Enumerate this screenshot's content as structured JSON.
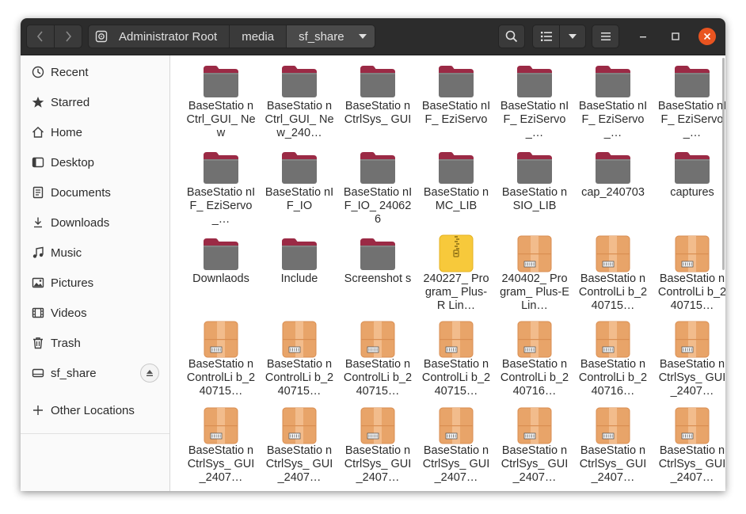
{
  "header": {
    "breadcrumbs": [
      "Administrator Root",
      "media",
      "sf_share"
    ],
    "icons": {
      "back": "chevron-left-icon",
      "forward": "chevron-right-icon",
      "search": "search-icon",
      "view": "list-view-icon",
      "view_dropdown": "chevron-down-icon",
      "menu": "hamburger-menu-icon",
      "minimize": "minimize-icon",
      "maximize": "maximize-icon",
      "close": "close-icon"
    }
  },
  "sidebar": {
    "items": [
      {
        "label": "Recent",
        "icon": "clock-icon"
      },
      {
        "label": "Starred",
        "icon": "star-icon"
      },
      {
        "label": "Home",
        "icon": "home-icon"
      },
      {
        "label": "Desktop",
        "icon": "desktop-icon"
      },
      {
        "label": "Documents",
        "icon": "document-icon"
      },
      {
        "label": "Downloads",
        "icon": "download-icon"
      },
      {
        "label": "Music",
        "icon": "music-icon"
      },
      {
        "label": "Pictures",
        "icon": "picture-icon"
      },
      {
        "label": "Videos",
        "icon": "video-icon"
      },
      {
        "label": "Trash",
        "icon": "trash-icon"
      },
      {
        "label": "sf_share",
        "icon": "drive-icon"
      }
    ],
    "other_locations": "Other Locations"
  },
  "files": [
    {
      "label": "BaseStatio nCtrl_GUI_ New",
      "type": "folder"
    },
    {
      "label": "BaseStatio nCtrl_GUI_ New_240…",
      "type": "folder"
    },
    {
      "label": "BaseStatio nCtrlSys_ GUI",
      "type": "folder"
    },
    {
      "label": "BaseStatio nIF_ EziServo",
      "type": "folder"
    },
    {
      "label": "BaseStatio nIF_ EziServo_…",
      "type": "folder"
    },
    {
      "label": "BaseStatio nIF_ EziServo_…",
      "type": "folder"
    },
    {
      "label": "BaseStatio nIF_ EziServo_…",
      "type": "folder"
    },
    {
      "label": "BaseStatio nIF_ EziServo_…",
      "type": "folder"
    },
    {
      "label": "BaseStatio nIF_IO",
      "type": "folder"
    },
    {
      "label": "BaseStatio nIF_IO_ 240626",
      "type": "folder"
    },
    {
      "label": "BaseStatio nMC_LIB",
      "type": "folder"
    },
    {
      "label": "BaseStatio nSIO_LIB",
      "type": "folder"
    },
    {
      "label": "cap_240703",
      "type": "folder"
    },
    {
      "label": "captures",
      "type": "folder"
    },
    {
      "label": "Downlaods",
      "type": "folder"
    },
    {
      "label": "Include",
      "type": "folder"
    },
    {
      "label": "Screenshot s",
      "type": "folder"
    },
    {
      "label": "240227_ Program_ Plus-R Lin…",
      "type": "zip"
    },
    {
      "label": "240402_ Program_ Plus-E Lin…",
      "type": "archive"
    },
    {
      "label": "BaseStatio nControlLi b_240715…",
      "type": "archive"
    },
    {
      "label": "BaseStatio nControlLi b_240715…",
      "type": "archive"
    },
    {
      "label": "BaseStatio nControlLi b_240715…",
      "type": "archive"
    },
    {
      "label": "BaseStatio nControlLi b_240715…",
      "type": "archive"
    },
    {
      "label": "BaseStatio nControlLi b_240715…",
      "type": "archive"
    },
    {
      "label": "BaseStatio nControlLi b_240715…",
      "type": "archive"
    },
    {
      "label": "BaseStatio nControlLi b_240716…",
      "type": "archive"
    },
    {
      "label": "BaseStatio nControlLi b_240716…",
      "type": "archive"
    },
    {
      "label": "BaseStatio nCtrlSys_ GUI_2407…",
      "type": "archive"
    },
    {
      "label": "BaseStatio nCtrlSys_ GUI_2407…",
      "type": "archive"
    },
    {
      "label": "BaseStatio nCtrlSys_ GUI_2407…",
      "type": "archive"
    },
    {
      "label": "BaseStatio nCtrlSys_ GUI_2407…",
      "type": "archive"
    },
    {
      "label": "BaseStatio nCtrlSys_ GUI_2407…",
      "type": "archive"
    },
    {
      "label": "BaseStatio nCtrlSys_ GUI_2407…",
      "type": "archive"
    },
    {
      "label": "BaseStatio nCtrlSys_ GUI_2407…",
      "type": "archive"
    },
    {
      "label": "BaseStatio nCtrlSys_ GUI_2407…",
      "type": "archive"
    }
  ],
  "colors": {
    "headerbar": "#2c2c2c",
    "accent_close": "#e95420",
    "folder_body": "#717171",
    "folder_tab": "#9b2a45",
    "archive": "#e8a469",
    "zip": "#f7c93b"
  }
}
